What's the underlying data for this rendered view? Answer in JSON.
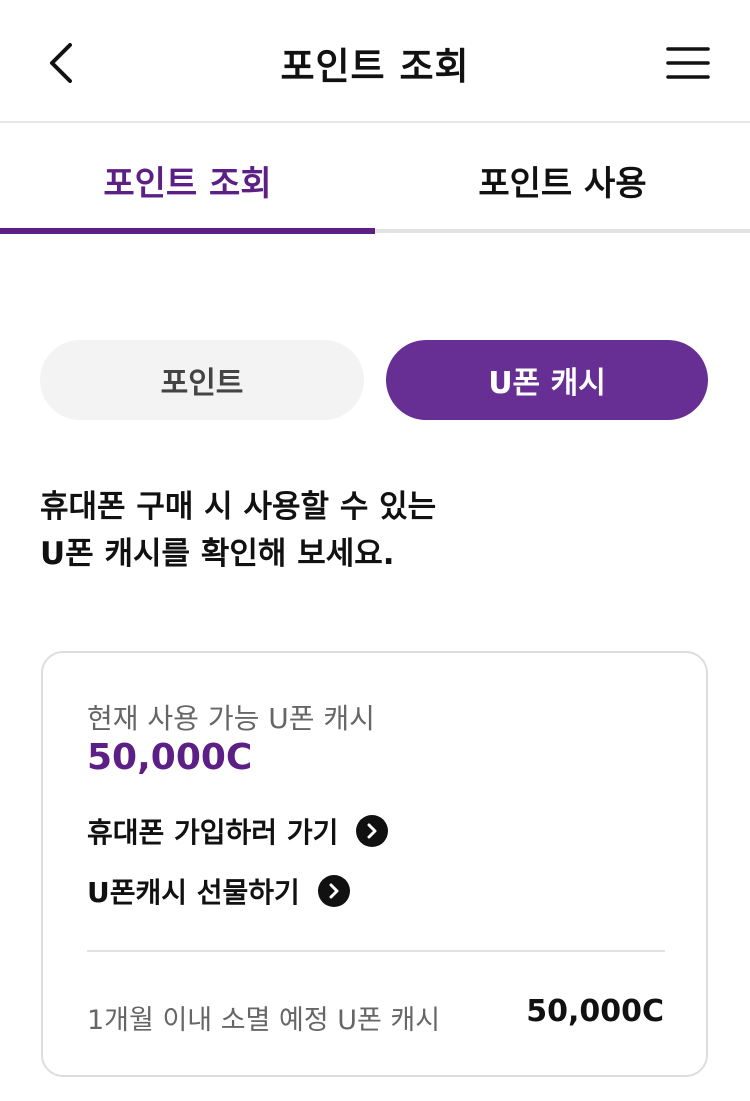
{
  "header": {
    "title": "포인트 조회",
    "back_icon": "chevron-left-icon",
    "menu_icon": "hamburger-menu-icon"
  },
  "tabs": [
    {
      "label": "포인트 조회",
      "active": true
    },
    {
      "label": "포인트 사용",
      "active": false
    }
  ],
  "segment": {
    "options": [
      {
        "label": "포인트",
        "selected": false
      },
      {
        "label": "U폰 캐시",
        "selected": true
      }
    ]
  },
  "description": {
    "line1": "휴대폰 구매 시 사용할 수 있는",
    "line2": "U폰 캐시를 확인해 보세요."
  },
  "card": {
    "available_label": "현재 사용 가능 U폰 캐시",
    "available_amount": "50,000C",
    "links": [
      {
        "label": "휴대폰 가입하러 가기",
        "icon": "arrow-right-circle-icon"
      },
      {
        "label": "U폰캐시 선물하기",
        "icon": "arrow-right-circle-icon"
      }
    ],
    "expire_label": "1개월 이내 소멸 예정 U폰 캐시",
    "expire_amount": "50,000C"
  },
  "colors": {
    "accent": "#5b1f86",
    "toggle_active": "#672f93",
    "toggle_inactive": "#f3f3f3",
    "divider": "#e2e2e2"
  }
}
